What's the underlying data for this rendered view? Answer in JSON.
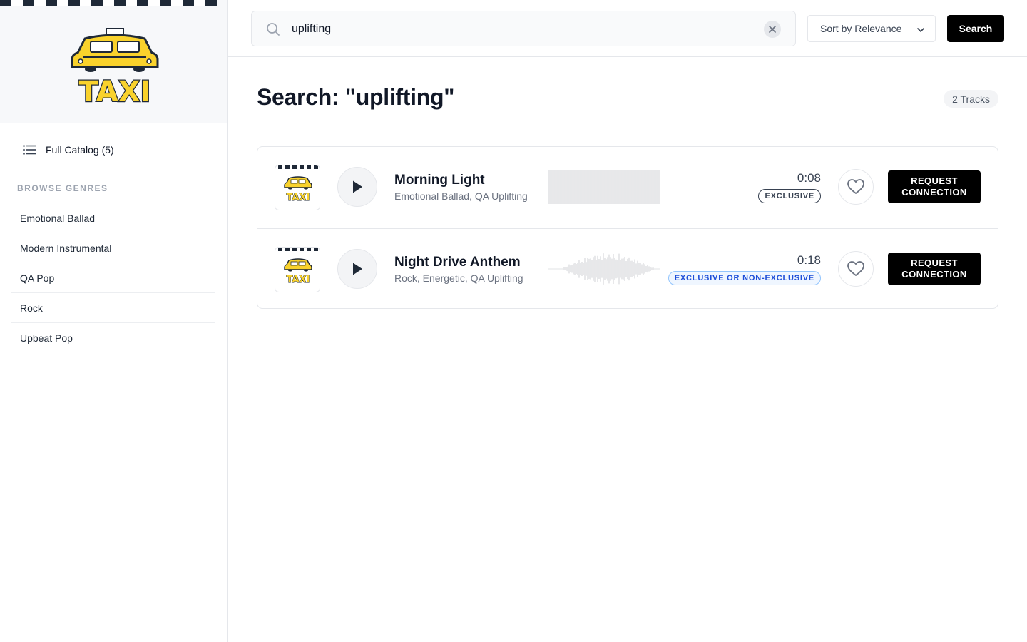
{
  "sidebar": {
    "brand": "TAXI",
    "full_catalog_label": "Full Catalog (5)",
    "browse_label": "BROWSE GENRES",
    "genres": [
      "Emotional Ballad",
      "Modern Instrumental",
      "QA Pop",
      "Rock",
      "Upbeat Pop"
    ]
  },
  "search": {
    "value": "uplifting",
    "sort_label": "Sort by Relevance",
    "button_label": "Search"
  },
  "main": {
    "title": "Search: \"uplifting\"",
    "count": "2 Tracks"
  },
  "tracks": [
    {
      "title": "Morning Light",
      "genres": "Emotional Ballad, QA Uplifting",
      "duration": "0:08",
      "license": "EXCLUSIVE",
      "request_label": "REQUEST\nCONNECTION"
    },
    {
      "title": "Night Drive Anthem",
      "genres": "Rock, Energetic, QA Uplifting",
      "duration": "0:18",
      "license": "EXCLUSIVE OR NON-EXCLUSIVE",
      "request_label": "REQUEST\nCONNECTION"
    }
  ],
  "colors": {
    "taxi_yellow": "#f9d22c",
    "dark": "#1f2937",
    "badge_blue": "#1d4ed8"
  }
}
